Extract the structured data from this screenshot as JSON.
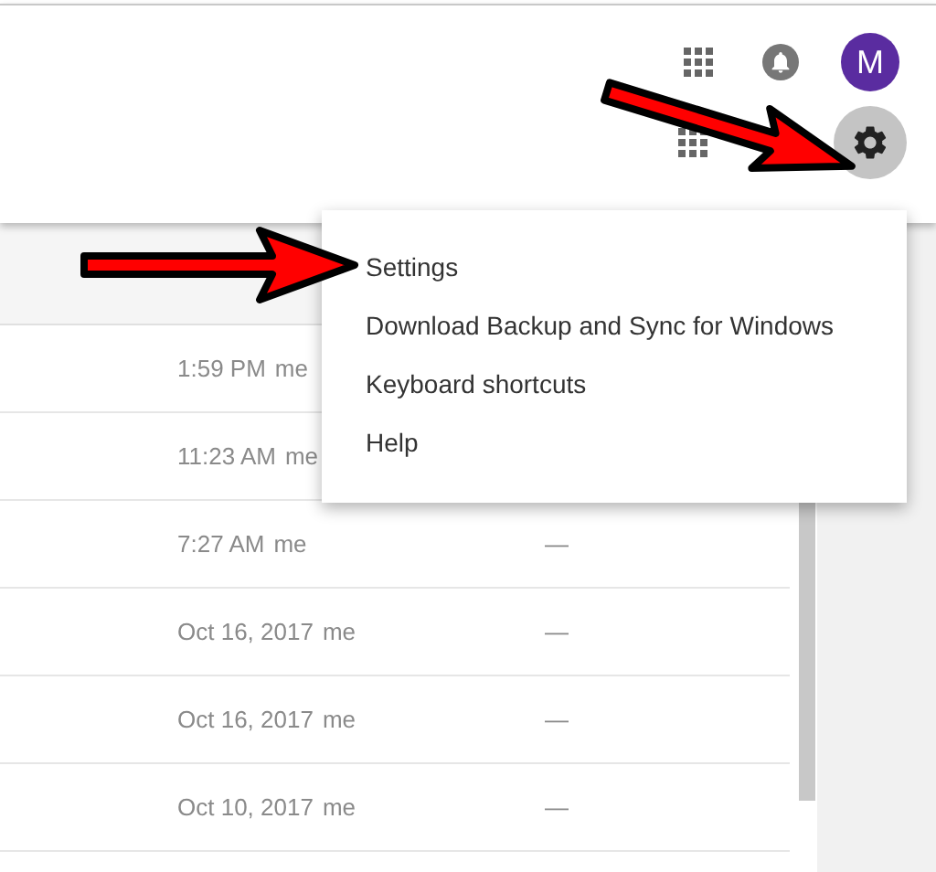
{
  "header": {
    "avatar_letter": "M"
  },
  "table": {
    "rows": [
      {
        "modified": "1:59 PM",
        "owner": "me"
      },
      {
        "modified": "11:23 AM",
        "owner": "me"
      },
      {
        "modified": "7:27 AM",
        "owner": "me",
        "column_3": "—"
      },
      {
        "modified": "Oct 16, 2017",
        "owner": "me",
        "column_3": "—"
      },
      {
        "modified": "Oct 16, 2017",
        "owner": "me",
        "column_3": "—"
      },
      {
        "modified": "Oct 10, 2017",
        "owner": "me",
        "column_3": "—"
      }
    ]
  },
  "menu": {
    "items": [
      {
        "label": "Settings"
      },
      {
        "label": "Download Backup and Sync for Windows"
      },
      {
        "label": "Keyboard shortcuts"
      },
      {
        "label": "Help"
      }
    ]
  }
}
